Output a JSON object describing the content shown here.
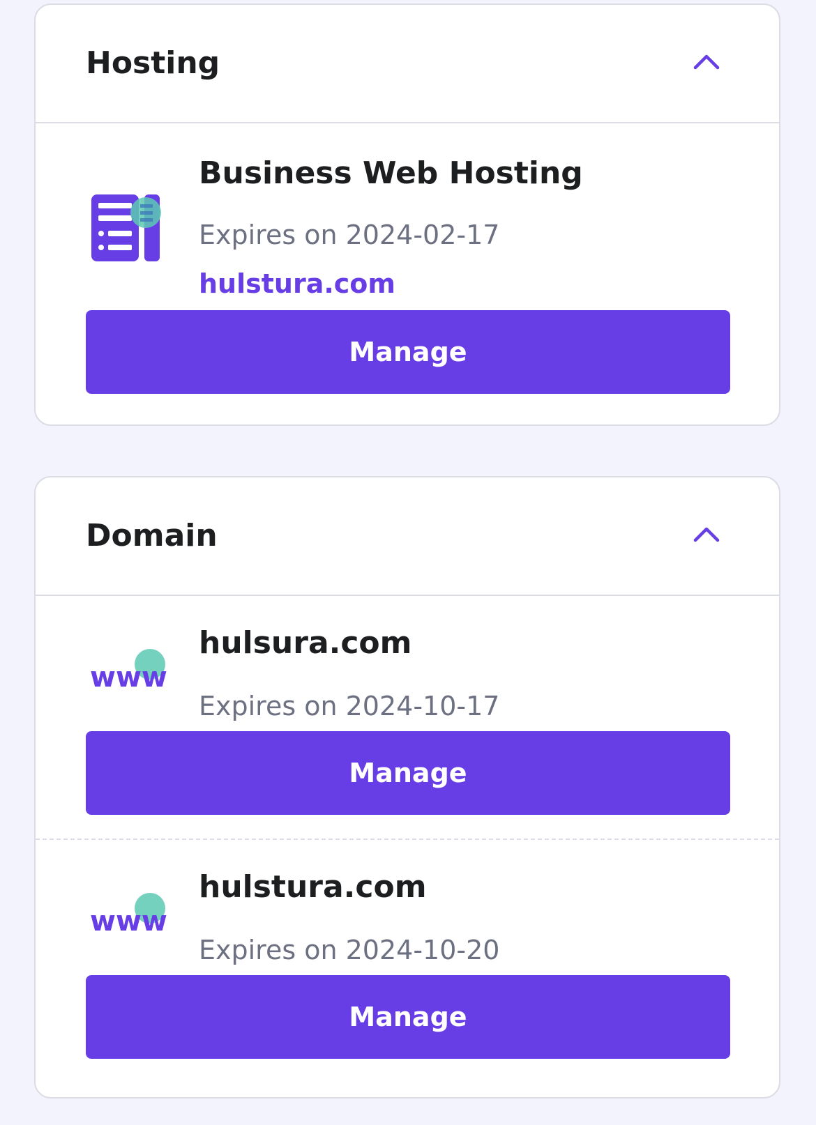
{
  "colors": {
    "accent": "#673de6",
    "accent_teal": "#5cc9b3",
    "text_primary": "#1d1e20",
    "text_secondary": "#6d7081",
    "page_bg": "#f3f3fd",
    "border": "#dcdce4"
  },
  "hosting": {
    "title": "Hosting",
    "toggle_icon": "chevron-up-icon",
    "items": [
      {
        "icon": "server-icon",
        "name": "Business Web Hosting",
        "expires": "Expires on 2024-02-17",
        "domain": "hulstura.com",
        "button_label": "Manage"
      }
    ]
  },
  "domain": {
    "title": "Domain",
    "toggle_icon": "chevron-up-icon",
    "items": [
      {
        "icon": "www-icon",
        "icon_text": "www",
        "name": "hulsura.com",
        "expires": "Expires on 2024-10-17",
        "button_label": "Manage"
      },
      {
        "icon": "www-icon",
        "icon_text": "www",
        "name": "hulstura.com",
        "expires": "Expires on 2024-10-20",
        "button_label": "Manage"
      }
    ]
  }
}
